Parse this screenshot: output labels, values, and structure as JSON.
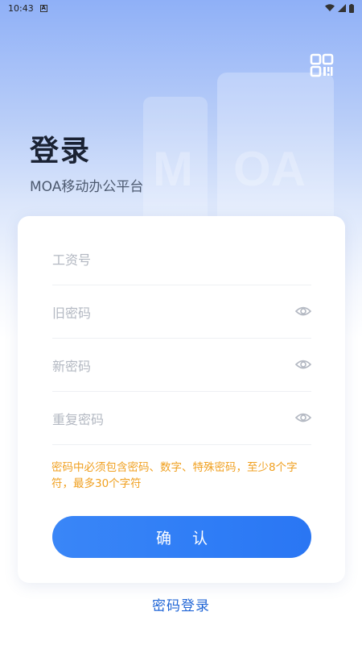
{
  "status_bar": {
    "time": "10:43",
    "notif_glyph": "A"
  },
  "header": {
    "title": "登录",
    "subtitle": "MOA移动办公平台",
    "qr_icon": "qr-scan-icon"
  },
  "form": {
    "fields": [
      {
        "placeholder": "工资号",
        "has_eye": false
      },
      {
        "placeholder": "旧密码",
        "has_eye": true
      },
      {
        "placeholder": "新密码",
        "has_eye": true
      },
      {
        "placeholder": "重复密码",
        "has_eye": true
      }
    ],
    "hint": "密码中必须包含密码、数字、特殊密码，至少8个字符，最多30个字符",
    "confirm_label": "确 认"
  },
  "footer": {
    "password_login": "密码登录"
  },
  "colors": {
    "accent": "#2f7df6",
    "hint": "#f0a020",
    "link": "#2166d6"
  }
}
